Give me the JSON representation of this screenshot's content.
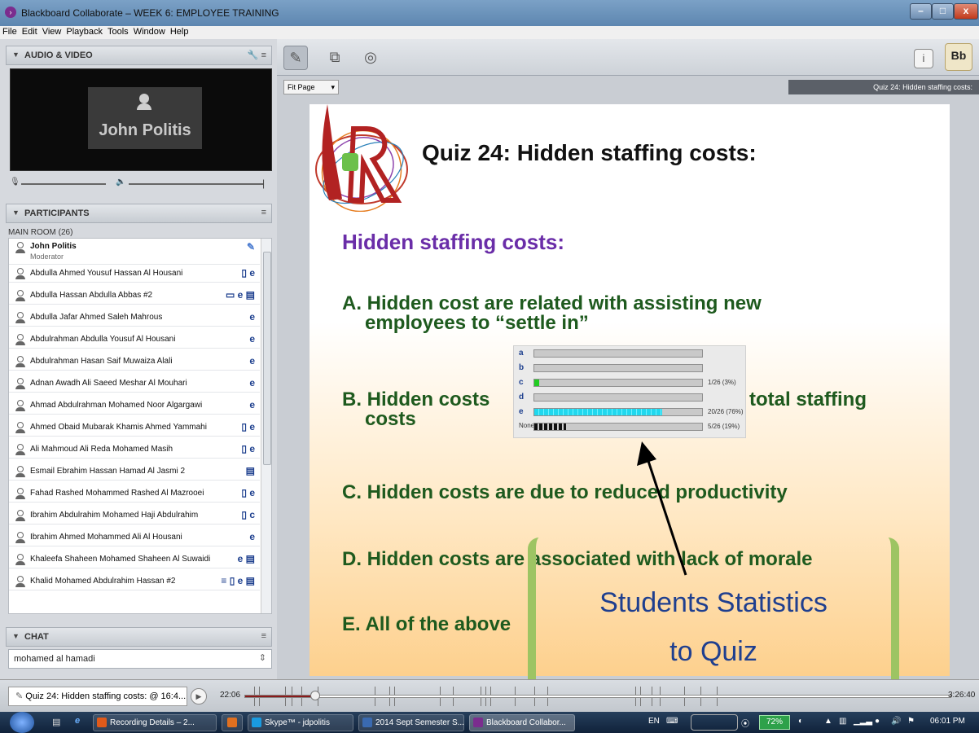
{
  "window": {
    "title": "Blackboard Collaborate – WEEK 6: EMPLOYEE TRAINING"
  },
  "menu": [
    "File",
    "Edit",
    "View",
    "Playback",
    "Tools",
    "Window",
    "Help"
  ],
  "audio_video": {
    "label": "AUDIO & VIDEO",
    "speaker_name": "John Politis"
  },
  "participants": {
    "label": "PARTICIPANTS",
    "room": "MAIN ROOM (26)",
    "moderator": {
      "name": "John Politis",
      "role": "Moderator"
    },
    "list": [
      {
        "name": "Abdulla Ahmed Yousuf Hassan Al Housani",
        "status": "▯ e"
      },
      {
        "name": "Abdulla Hassan Abdulla Abbas #2",
        "status": "▭ e ▤"
      },
      {
        "name": "Abdulla Jafar Ahmed Saleh Mahrous",
        "status": "e"
      },
      {
        "name": "Abdulrahman Abdulla Yousuf Al Housani",
        "status": "e"
      },
      {
        "name": "Abdulrahman Hasan Saif Muwaiza Alali",
        "status": "e"
      },
      {
        "name": "Adnan Awadh Ali Saeed Meshar Al Mouhari",
        "status": "e"
      },
      {
        "name": "Ahmad Abdulrahman Mohamed Noor Algargawi",
        "status": "e"
      },
      {
        "name": "Ahmed Obaid Mubarak Khamis Ahmed Yammahi",
        "status": "▯ e"
      },
      {
        "name": "Ali Mahmoud Ali Reda Mohamed Masih",
        "status": "▯ e"
      },
      {
        "name": "Esmail Ebrahim Hassan Hamad Al Jasmi 2",
        "status": "▤"
      },
      {
        "name": "Fahad Rashed Mohammed Rashed Al Mazrooei",
        "status": "▯ e"
      },
      {
        "name": "Ibrahim Abdulrahim Mohamed Haji Abdulrahim",
        "status": "▯ c"
      },
      {
        "name": "Ibrahim Ahmed Mohammed Ali Al Housani",
        "status": "e"
      },
      {
        "name": "Khaleefa Shaheen Mohamed Shaheen Al Suwaidi",
        "status": "e ▤"
      },
      {
        "name": "Khalid Mohamed Abdulrahim Hassan #2",
        "status": "≡ ▯ e ▤"
      }
    ]
  },
  "chat": {
    "label": "CHAT",
    "input_value": "mohamed al hamadi"
  },
  "viewer": {
    "fit_label": "Fit Page",
    "tab_title": "Quiz 24: Hidden staffing costs:"
  },
  "slide": {
    "title": "Quiz 24: Hidden staffing costs:",
    "subtitle": "Hidden staffing costs:",
    "option_a_1": "A. Hidden cost are related with assisting new",
    "option_a_2": "employees to “settle in”",
    "option_b_left": "B. Hidden costs",
    "option_b_right": "total staffing",
    "option_b_2": "costs",
    "option_c": "C. Hidden costs are due to reduced productivity",
    "option_d": "D. Hidden costs are associated with lack of morale",
    "option_e": "E.  All of the above"
  },
  "poll": {
    "rows": [
      {
        "letter": "a",
        "fraction": 0,
        "label": "",
        "color": ""
      },
      {
        "letter": "b",
        "fraction": 0,
        "label": "",
        "color": ""
      },
      {
        "letter": "c",
        "fraction": 0.03,
        "label": "1/26 (3%)",
        "color": "#22cc22"
      },
      {
        "letter": "d",
        "fraction": 0,
        "label": "",
        "color": ""
      },
      {
        "letter": "e",
        "fraction": 0.76,
        "label": "20/26 (76%)",
        "color": "#20d8ee"
      },
      {
        "letter": "None",
        "fraction": 0.19,
        "label": "5/26 (19%)",
        "color": "#111111"
      }
    ]
  },
  "annotation": {
    "line1": "Students Statistics",
    "line2": "to Quiz"
  },
  "playback": {
    "current_item": "Quiz 24: Hidden staffing costs:  @ 16:4...",
    "position": "22:06",
    "duration": "3:26:40"
  },
  "taskbar": {
    "items": [
      {
        "label": "Recording Details – 2...",
        "color": "#e05a1a"
      },
      {
        "label": "",
        "color": "#e07020"
      },
      {
        "label": "Skype™ - jdpolitis",
        "color": "#1a9be0"
      },
      {
        "label": "2014 Sept Semester S...",
        "color": "#3a6ab0"
      },
      {
        "label": "Blackboard Collabor...",
        "color": "#7b2d8e"
      }
    ],
    "lang": "EN",
    "battery": "72%",
    "time": "06:01 PM"
  }
}
